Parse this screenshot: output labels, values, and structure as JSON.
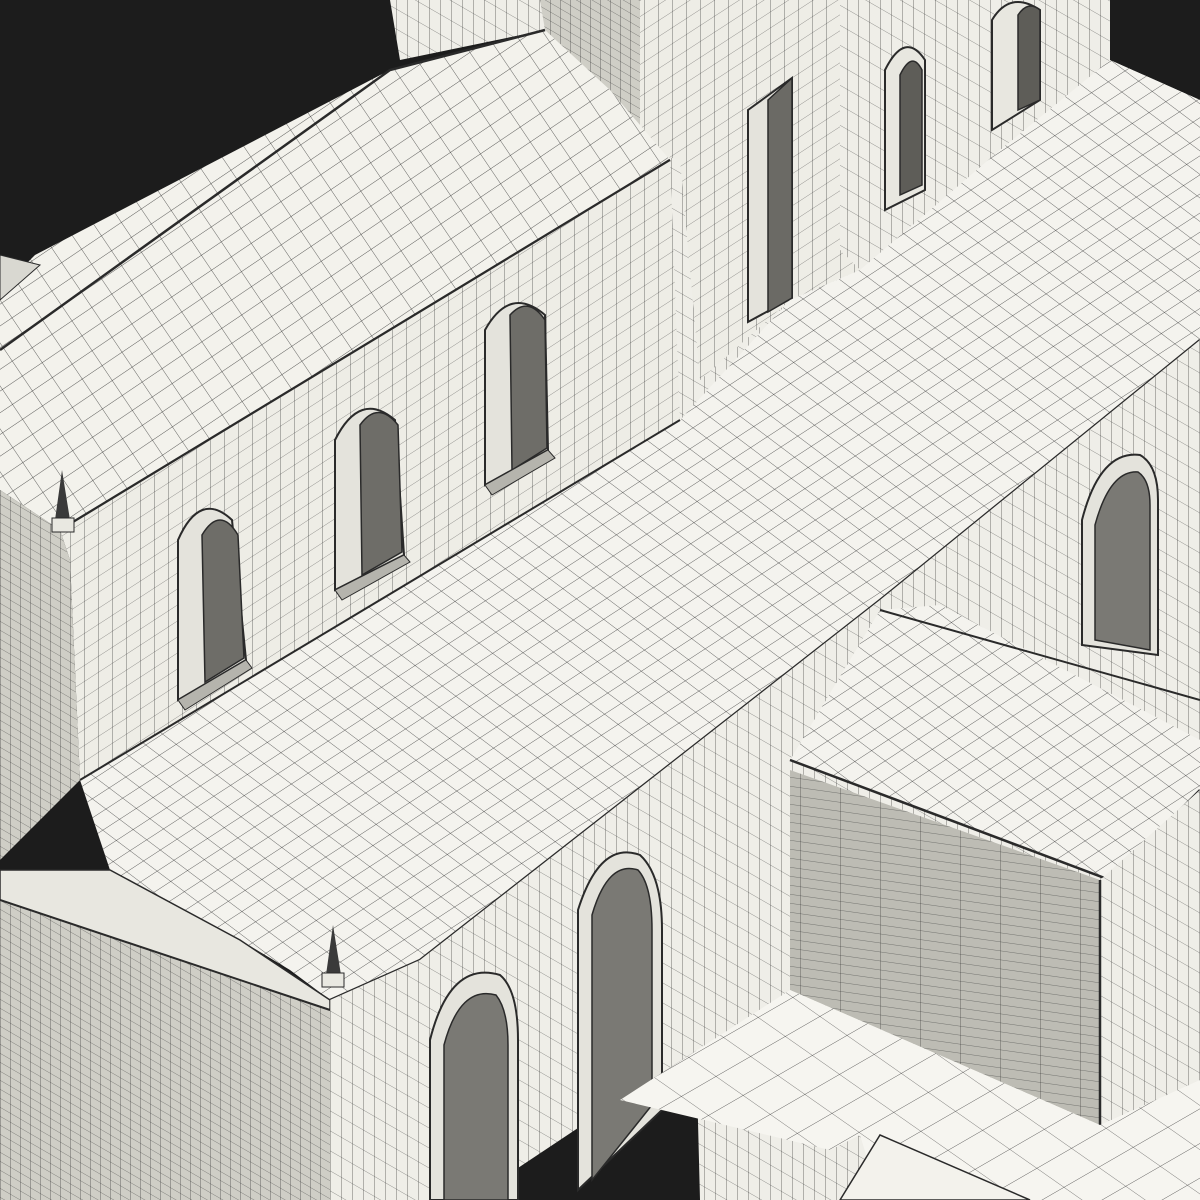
{
  "scene": {
    "background_color": "#1c1c1c",
    "surface_color": "#f3f2ec",
    "shadow_color": "#c9c8c0",
    "deep_shadow_color": "#8f8e87",
    "wire_color": "#2a2a2a"
  }
}
